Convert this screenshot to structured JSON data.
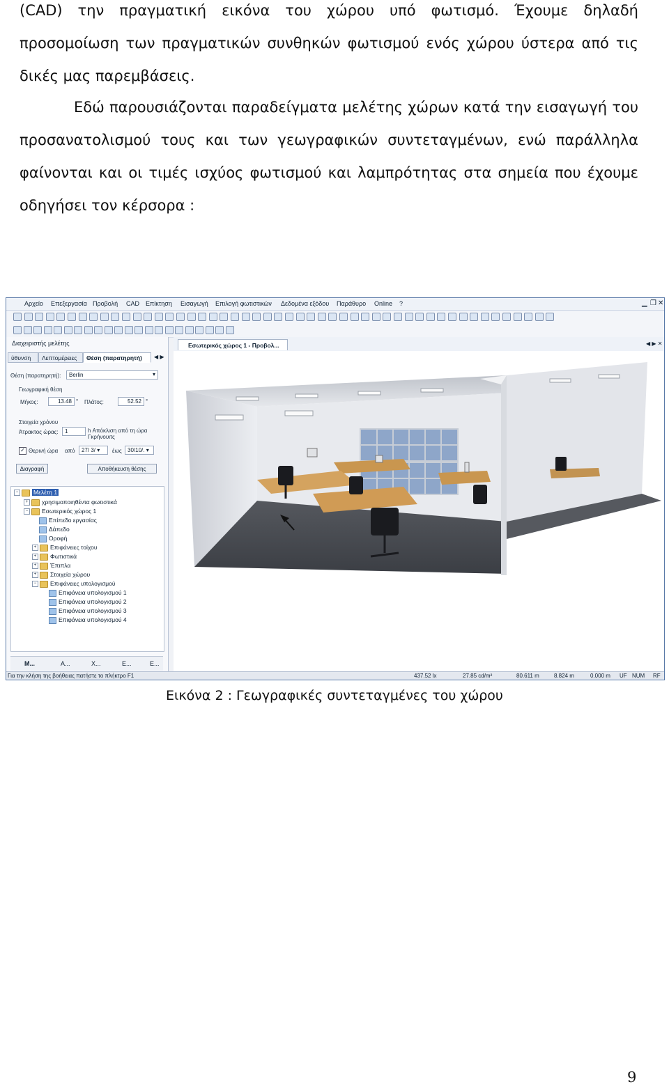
{
  "paragraphs": {
    "p1": "(CAD) την πραγματική εικόνα του χώρου υπό φωτισμό. Έχουμε δηλαδή προσομοίωση των πραγματικών συνθηκών φωτισμού ενός χώρου ύστερα από τις δικές μας παρεμβάσεις.",
    "p2": "Εδώ παρουσιάζονται παραδείγματα μελέτης χώρων κατά την εισαγωγή του προσανατολισμού τους και των γεωγραφικών συντεταγμένων, ενώ παράλληλα φαίνονται και οι τιμές ισχύος φωτισμού και λαμπρότητας στα σημεία που έχουμε οδηγήσει τον κέρσορα :"
  },
  "app": {
    "menu": [
      "Αρχείο",
      "Επεξεργασία",
      "Προβολή",
      "CAD",
      "Επίκτηση",
      "Εισαγωγή",
      "Επιλογή φωτιστικών",
      "Δεδομένα εξόδου",
      "Παράθυρο",
      "Online",
      "?"
    ],
    "left_panel": {
      "title": "Διαχειριστής μελέτης",
      "tabs": [
        "ύθυνση",
        "Λεπτομέρειες",
        "Θέση (παρατηρητή)"
      ],
      "location_label": "Θέση (παρατηρητή):",
      "location_value": "Berlin",
      "geo_group": "Γεωγραφική θέση",
      "longitude_label": "Μήκος:",
      "longitude_value": "13.48",
      "latitude_label": "Πλάτος:",
      "latitude_value": "52.52",
      "time_group": "Στοιχεία χρόνου",
      "tz_label": "Άτρακτος ώρας:",
      "tz_value": "1",
      "tz_note": "h Απόκλιση από τη ώρα Γκρήνουιτς",
      "dst_label": "Θερινή ώρα",
      "from_label": "από",
      "from_value": "27/ 3/",
      "to_label": "έως",
      "to_value": "30/10/.",
      "delete_btn": "Διαγραφή",
      "save_btn": "Αποθήκευση θέσης"
    },
    "tree": [
      "Μελέτη 1",
      "χρησιμοποιηθέντα φωτιστικά",
      "Εσωτερικός χώρος 1",
      "Επίπεδο εργασίας",
      "Δάπεδο",
      "Οροφή",
      "Επιφάνειες τοίχου",
      "Φωτιστικά",
      "Έπιπλα",
      "Στοιχεία χώρου",
      "Επιφάνειες υπολογισμού",
      "Επιφάνεια υπολογισμού 1",
      "Επιφάνεια υπολογισμού 2",
      "Επιφάνεια υπολογισμού 3",
      "Επιφάνεια υπολογισμού 4"
    ],
    "bottom_tabs": [
      "M...",
      "A...",
      "X...",
      "E...",
      "E..."
    ],
    "view_tab": "Εσωτερικός χώρος 1 - Προβολ...",
    "status": {
      "help": "Για την κλήση της βοήθειας πατήστε το πλήκτρο F1",
      "illuminance": "437.52 lx",
      "luminance": "27.85 cd/m²",
      "x": "80.611 m",
      "y": "8.824 m",
      "z": "0.000 m",
      "mode1": "UF",
      "mode2": "NUM",
      "mode3": "RF"
    }
  },
  "caption": "Εικόνα 2 : Γεωγραφικές συντεταγμένες του χώρου",
  "page_number": "9"
}
